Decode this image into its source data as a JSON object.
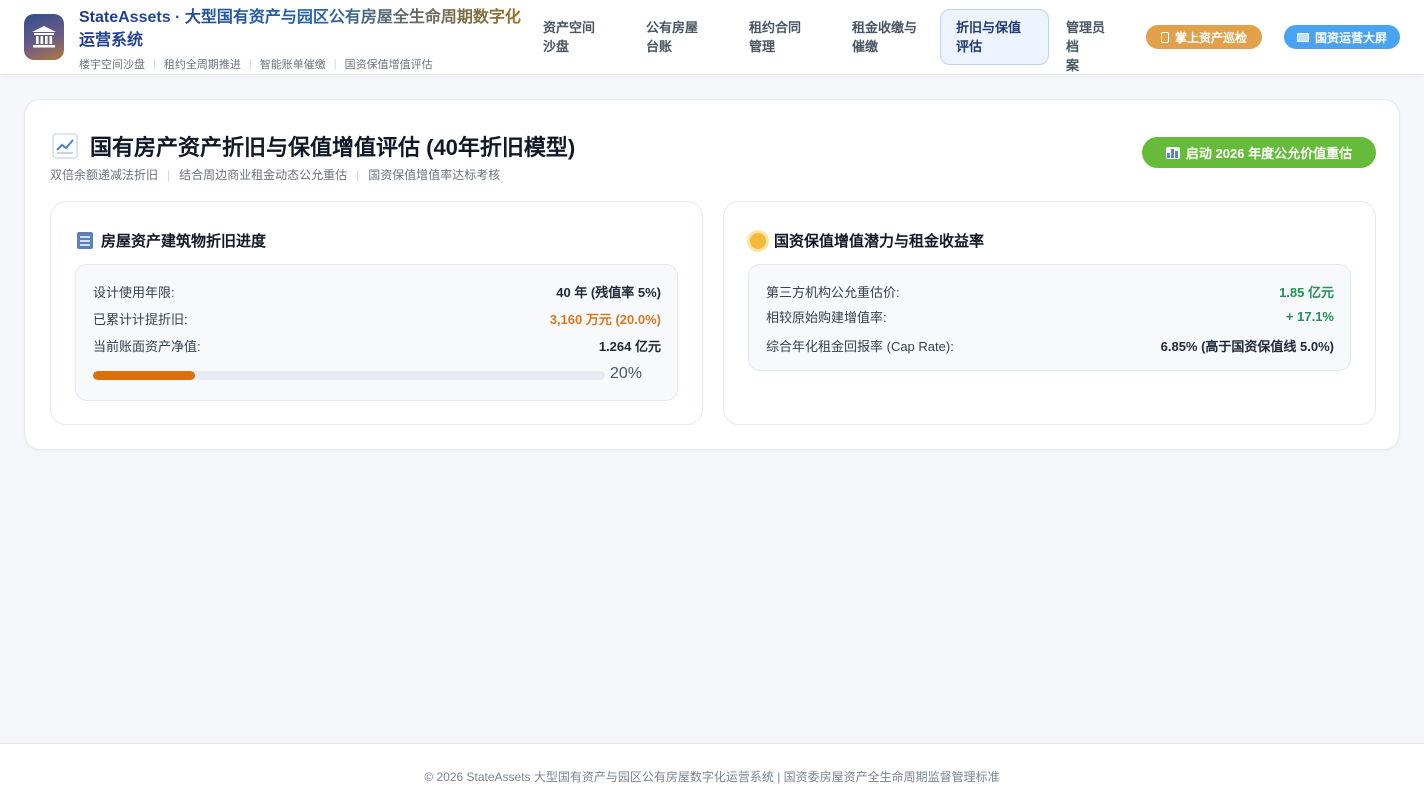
{
  "header": {
    "app_title": "StateAssets · 大型国有资产与园区公有房屋全生命周期数字化运营系统",
    "sub_tags": [
      "楼宇空间沙盘",
      "租约全周期推进",
      "智能账单催缴",
      "国资保值增值评估"
    ],
    "nav": [
      {
        "line1": "资产空间",
        "line2": "沙盘"
      },
      {
        "line1": "公有房屋",
        "line2": "台账"
      },
      {
        "line1": "租约合同",
        "line2": "管理"
      },
      {
        "line1": "租金收缴与",
        "line2": "催缴"
      },
      {
        "line1": "折旧与保值",
        "line2": "评估"
      },
      {
        "line1": "管理员档",
        "line2": "案"
      }
    ],
    "active_nav": "折旧与保值评估",
    "mobile_button": "掌上资产巡检",
    "screen_button": "国资运营大屏"
  },
  "main": {
    "title": "国有房产资产折旧与保值增值评估 (40年折旧模型)",
    "subtitle_parts": [
      "双倍余额递减法折旧",
      "结合周边商业租金动态公允重估",
      "国资保值增值率达标考核"
    ],
    "revalue_button": "启动 2026 年度公允价值重估"
  },
  "depreciation": {
    "title": "房屋资产建筑物折旧进度",
    "rows": [
      {
        "label": "设计使用年限:",
        "value": "40 年 (残值率 5%)"
      },
      {
        "label": "已累计计提折旧:",
        "value": "3,160 万元 (20.0%)"
      },
      {
        "label": "当前账面资产净值:",
        "value": "1.264 亿元"
      }
    ],
    "progress_fraction": 0.2,
    "progress_label": "20%"
  },
  "appreciation": {
    "title": "国资保值增值潜力与租金收益率",
    "rows": [
      {
        "label": "第三方机构公允重估价:",
        "value": "1.85 亿元"
      },
      {
        "label": "相较原始购建增值率:",
        "value": "+ 17.1%"
      },
      {
        "label": "综合年化租金回报率 (Cap Rate):",
        "value": "6.85% (高于国资保值线 5.0%)"
      }
    ]
  },
  "colors": {
    "accent_green": "#66bb3a",
    "progress_orange": "#d9700c",
    "value_green": "#1f9254",
    "value_orange": "#d9791c",
    "mobile_pill": "#e2a04a",
    "screen_pill": "#4aa3f2"
  },
  "icons": {
    "logo": "bank-building-icon",
    "title": "chart-trend-icon",
    "depreciation": "office-building-icon",
    "appreciation": "sun-icon",
    "mobile": "phone-icon",
    "screen": "monitor-icon",
    "revalue": "bar-chart-icon"
  },
  "footer": {
    "text": "© 2026 StateAssets 大型国有资产与园区公有房屋数字化运营系统 | 国资委房屋资产全生命周期监督管理标准"
  }
}
